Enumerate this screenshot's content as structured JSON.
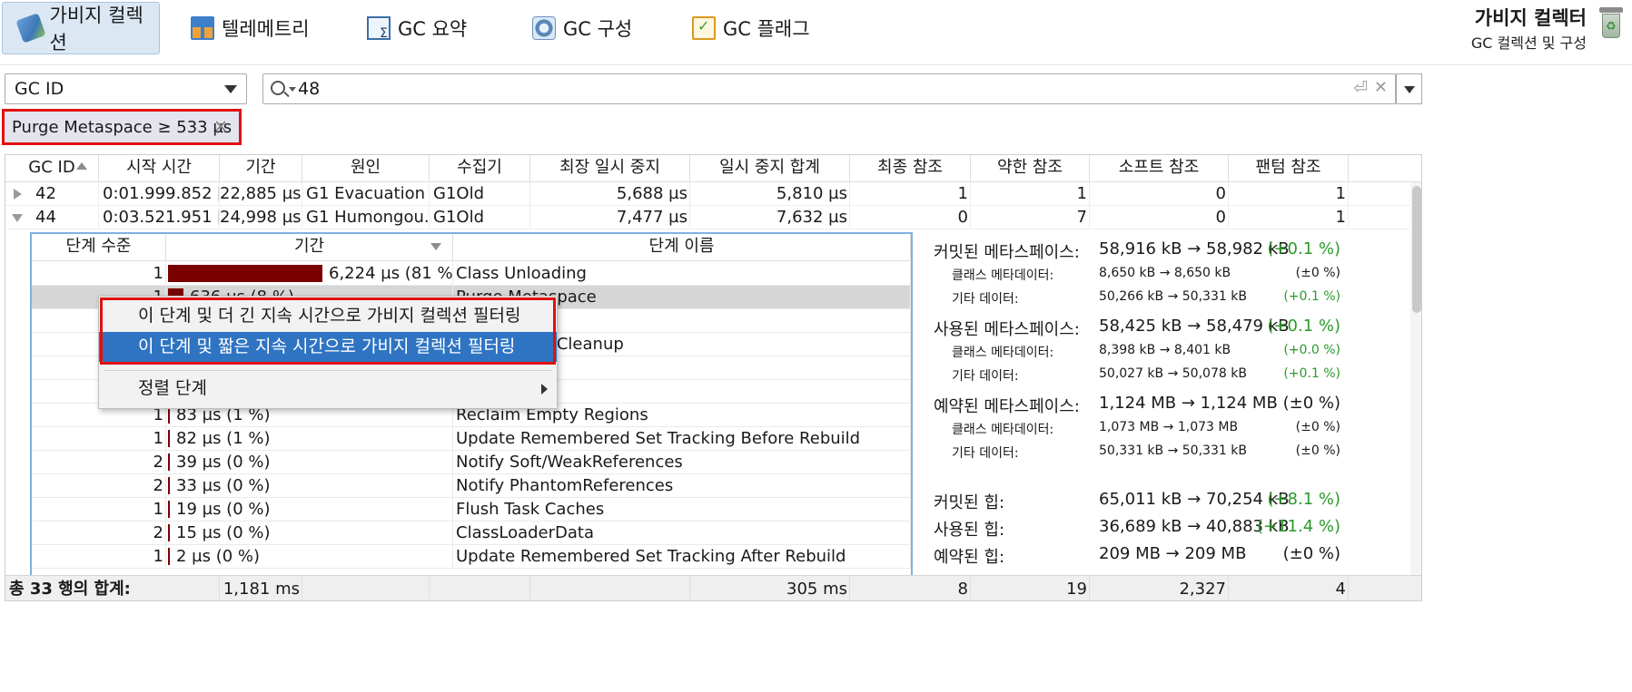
{
  "tabs": [
    {
      "label": "가비지 컬렉션",
      "icon": "garbage-collection-icon",
      "active": true
    },
    {
      "label": "텔레메트리",
      "icon": "telemetry-icon"
    },
    {
      "label": "GC 요약",
      "icon": "gc-summary-icon"
    },
    {
      "label": "GC 구성",
      "icon": "gc-config-icon"
    },
    {
      "label": "GC 플래그",
      "icon": "gc-flags-icon"
    }
  ],
  "header": {
    "title": "가비지 컬렉터",
    "subtitle": "GC 컬렉션 및 구성"
  },
  "filter": {
    "field": "GC ID",
    "query": "48",
    "chip": "Purge Metaspace ≥ 533 µs"
  },
  "table": {
    "columns": [
      "GC ID",
      "시작 시간",
      "기간",
      "원인",
      "수집기",
      "최장 일시 중지",
      "일시 중지 합계",
      "최종 참조",
      "약한 참조",
      "소프트 참조",
      "팬텀 참조"
    ],
    "rows": [
      {
        "gc_id": "42",
        "start": "0:01.999.852 [...",
        "duration": "22,885 µs",
        "cause": "G1 Evacuation ...",
        "collector": "G1Old",
        "longest_pause": "5,688 µs",
        "sum_pause": "5,810 µs",
        "final_refs": "1",
        "weak_refs": "1",
        "soft_refs": "0",
        "phantom_refs": "1",
        "expanded": false
      },
      {
        "gc_id": "44",
        "start": "0:03.521.951 [...",
        "duration": "24,998 µs",
        "cause": "G1 Humongou...",
        "collector": "G1Old",
        "longest_pause": "7,477 µs",
        "sum_pause": "7,632 µs",
        "final_refs": "0",
        "weak_refs": "7",
        "soft_refs": "0",
        "phantom_refs": "1",
        "expanded": true
      }
    ],
    "totals": {
      "label": "총 33 행의 합계:",
      "duration": "1,181 ms",
      "sum_pause": "305 ms",
      "final_refs": "8",
      "weak_refs": "19",
      "soft_refs": "2,327",
      "phantom_refs": "4"
    }
  },
  "phases": {
    "columns": [
      "단계 수준",
      "기간",
      "단계 이름"
    ],
    "rows": [
      {
        "level": "1",
        "duration": "6,224 µs (81 %)",
        "name": "Class Unloading",
        "pct": 81
      },
      {
        "level": "1",
        "duration": "636 µs (8 %)",
        "name": "Purge Metaspace",
        "pct": 8,
        "selected": true
      },
      {
        "level": "",
        "duration": "",
        "name": "ing",
        "pct": 0
      },
      {
        "level": "",
        "duration": "",
        "name": "urrent Mark Cleanup",
        "pct": 0
      },
      {
        "level": "",
        "duration": "",
        "name": "ing",
        "pct": 0
      },
      {
        "level": "",
        "duration": "",
        "name": "cessing",
        "pct": 0
      },
      {
        "level": "1",
        "duration": "83 µs (1 %)",
        "name": "Reclaim Empty Regions",
        "pct": 1
      },
      {
        "level": "1",
        "duration": "82 µs (1 %)",
        "name": "Update Remembered Set Tracking Before Rebuild",
        "pct": 1
      },
      {
        "level": "2",
        "duration": "39 µs (0 %)",
        "name": "Notify Soft/WeakReferences",
        "pct": 0
      },
      {
        "level": "2",
        "duration": "33 µs (0 %)",
        "name": "Notify PhantomReferences",
        "pct": 0
      },
      {
        "level": "1",
        "duration": "19 µs (0 %)",
        "name": "Flush Task Caches",
        "pct": 0
      },
      {
        "level": "2",
        "duration": "15 µs (0 %)",
        "name": "ClassLoaderData",
        "pct": 0
      },
      {
        "level": "1",
        "duration": "2 µs (0 %)",
        "name": "Update Remembered Set Tracking After Rebuild",
        "pct": 0
      }
    ]
  },
  "metaspace": [
    {
      "label": "커밋된 메타스페이스:",
      "value": "58,916 kB → 58,982 kB",
      "delta": "(+0.1 %)",
      "size": "big",
      "positive": true
    },
    {
      "label": "클래스 메타데이터:",
      "value": "8,650 kB → 8,650 kB",
      "delta": "(±0 %)",
      "size": "small",
      "positive": false
    },
    {
      "label": "기타 데이터:",
      "value": "50,266 kB → 50,331 kB",
      "delta": "(+0.1 %)",
      "size": "small",
      "positive": true
    },
    {
      "label": "사용된 메타스페이스:",
      "value": "58,425 kB → 58,479 kB",
      "delta": "(+0.1 %)",
      "size": "big",
      "positive": true
    },
    {
      "label": "클래스 메타데이터:",
      "value": "8,398 kB → 8,401 kB",
      "delta": "(+0.0 %)",
      "size": "small",
      "positive": true
    },
    {
      "label": "기타 데이터:",
      "value": "50,027 kB → 50,078 kB",
      "delta": "(+0.1 %)",
      "size": "small",
      "positive": true
    },
    {
      "label": "예약된 메타스페이스:",
      "value": "1,124 MB → 1,124 MB",
      "delta": "(±0 %)",
      "size": "big",
      "positive": false
    },
    {
      "label": "클래스 메타데이터:",
      "value": "1,073 MB → 1,073 MB",
      "delta": "(±0 %)",
      "size": "small",
      "positive": false
    },
    {
      "label": "기타 데이터:",
      "value": "50,331 kB → 50,331 kB",
      "delta": "(±0 %)",
      "size": "small",
      "positive": false
    },
    {
      "label": "커밋된 힙:",
      "value": "65,011 kB → 70,254 kB",
      "delta": "(+8.1 %)",
      "size": "big",
      "positive": true
    },
    {
      "label": "사용된 힙:",
      "value": "36,689 kB → 40,883 kB",
      "delta": "(+11.4 %)",
      "size": "big",
      "positive": true
    },
    {
      "label": "예약된 힙:",
      "value": "209 MB → 209 MB",
      "delta": "(±0 %)",
      "size": "big",
      "positive": false
    }
  ],
  "context_menu": {
    "items": [
      "이 단계 및 더 긴 지속 시간으로 가비지 컬렉션 필터링",
      "이 단계 및 짧은 지속 시간으로 가비지 컬렉션 필터링"
    ],
    "sort_label": "정렬 단계"
  },
  "colors": {
    "accent": "#2f74c2",
    "bar": "#7a0000",
    "highlight_box": "#e01010",
    "positive": "#2a9a2a"
  }
}
